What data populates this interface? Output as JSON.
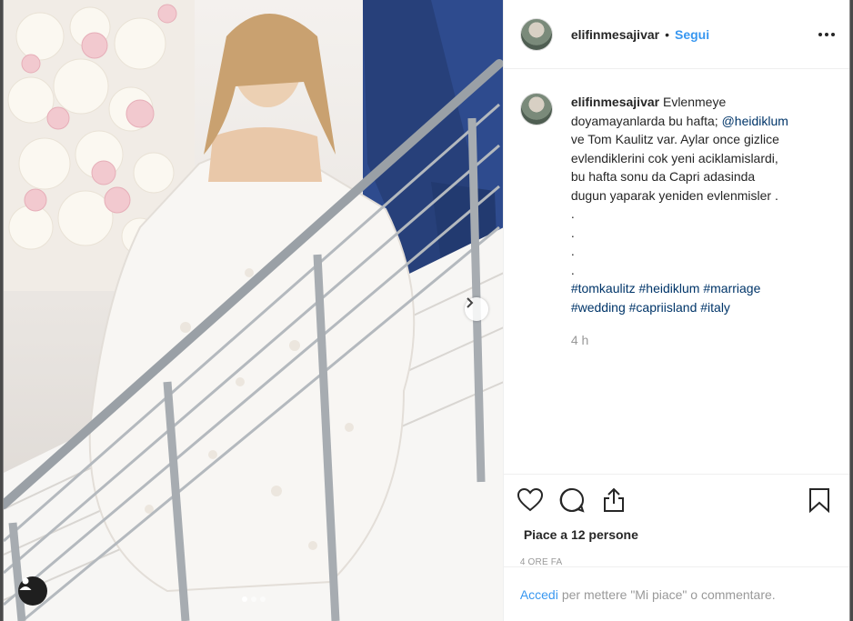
{
  "author": {
    "username": "elifinmesajivar",
    "separator": "•",
    "follow_label": "Segui"
  },
  "caption": {
    "username": "elifinmesajivar",
    "text_1": "Evlenmeye",
    "text_2": "doyamayanlarda bu hafta;",
    "mention": "@heidiklum",
    "text_3": "ve Tom Kaulitz var. Aylar once gizlice",
    "text_4": "evlendiklerini cok yeni aciklamislardi,",
    "text_5": "bu hafta sonu da Capri adasinda",
    "text_6": "dugun yaparak yeniden evlenmisler .",
    "dots": [
      ".",
      ".",
      ".",
      "."
    ],
    "hashtags_line1": [
      "#tomkaulitz",
      "#heidiklum",
      "#marriage"
    ],
    "hashtags_line2": [
      "#wedding",
      "#capriisland",
      "#italy"
    ],
    "relative_time": "4 h"
  },
  "actions": {
    "like_icon": "heart-icon",
    "comment_icon": "comment-icon",
    "share_icon": "share-icon",
    "save_icon": "bookmark-icon",
    "likes_text": "Piace a 12 persone",
    "timestamp": "4 ORE FA"
  },
  "login_bar": {
    "login_link": "Accedi",
    "prompt": "per mettere \"Mi piace\" o commentare."
  },
  "carousel": {
    "slides": 3,
    "active_slide": 1
  },
  "colors": {
    "link_blue": "#3897f0",
    "mention_blue": "#003569",
    "muted": "#999999"
  }
}
